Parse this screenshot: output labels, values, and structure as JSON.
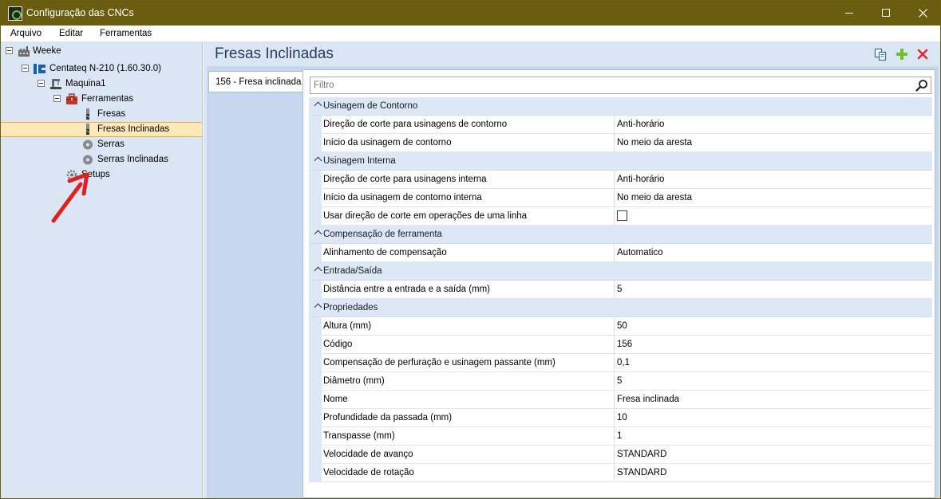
{
  "window": {
    "title": "Configuração das CNCs",
    "controls": [
      "minimize",
      "maximize",
      "close"
    ]
  },
  "menu": {
    "items": [
      {
        "label": "Arquivo"
      },
      {
        "label": "Editar"
      },
      {
        "label": "Ferramentas"
      }
    ]
  },
  "tree": {
    "nodes": [
      {
        "label": "Weeke",
        "icon": "factory-icon",
        "level": 0
      },
      {
        "label": "Centateq N-210 (1.60.30.0)",
        "icon": "machine-logo-icon",
        "level": 1
      },
      {
        "label": "Maquina1",
        "icon": "machine-icon",
        "level": 2
      },
      {
        "label": "Ferramentas",
        "icon": "toolbox-icon",
        "level": 3
      },
      {
        "label": "Fresas",
        "icon": "mill-tool-icon",
        "level": 4
      },
      {
        "label": "Fresas Inclinadas",
        "icon": "mill-tool-icon",
        "level": 4,
        "selected": true
      },
      {
        "label": "Serras",
        "icon": "saw-icon",
        "level": 4
      },
      {
        "label": "Serras Inclinadas",
        "icon": "saw-icon",
        "level": 4
      },
      {
        "label": "Setups",
        "icon": "gear-icon",
        "level": 3
      }
    ]
  },
  "content": {
    "title": "Fresas Inclinadas",
    "toolbar": {
      "copy_icon": "copy-icon",
      "add_icon": "add-icon",
      "delete_icon": "delete-icon"
    },
    "tab_label": "156 - Fresa inclinada",
    "filter_placeholder": "Filtro"
  },
  "grid": {
    "categories": [
      {
        "label": "Usinagem de Contorno",
        "rows": [
          {
            "name": "Direção de corte para usinagens de contorno",
            "value": "Anti-horário"
          },
          {
            "name": "Início da usinagem de contorno",
            "value": "No meio da aresta"
          }
        ]
      },
      {
        "label": "Usinagem Interna",
        "rows": [
          {
            "name": "Direção de corte para usinagens interna",
            "value": "Anti-horário"
          },
          {
            "name": "Início da usinagem de contorno interna",
            "value": "No meio da aresta"
          },
          {
            "name": "Usar direção de corte em operações de uma linha",
            "checkbox": false
          }
        ]
      },
      {
        "label": "Compensação de ferramenta",
        "rows": [
          {
            "name": "Alinhamento de compensação",
            "value": "Automatico"
          }
        ]
      },
      {
        "label": "Entrada/Saída",
        "rows": [
          {
            "name": "Distância entre a entrada e a saída (mm)",
            "value": "5"
          }
        ]
      },
      {
        "label": "Propriedades",
        "rows": [
          {
            "name": "Altura (mm)",
            "value": "50"
          },
          {
            "name": "Código",
            "value": "156"
          },
          {
            "name": "Compensação de perfuração e usinagem passante (mm)",
            "value": "0,1"
          },
          {
            "name": "Diâmetro (mm)",
            "value": "5"
          },
          {
            "name": "Nome",
            "value": "Fresa inclinada"
          },
          {
            "name": "Profundidade da passada (mm)",
            "value": "10"
          },
          {
            "name": "Transpasse (mm)",
            "value": "1"
          },
          {
            "name": "Velocidade de avanço",
            "value": "STANDARD"
          },
          {
            "name": "Velocidade de rotação",
            "value": "STANDARD"
          }
        ]
      }
    ]
  },
  "annotation": {
    "arrow_color": "#e02020"
  }
}
